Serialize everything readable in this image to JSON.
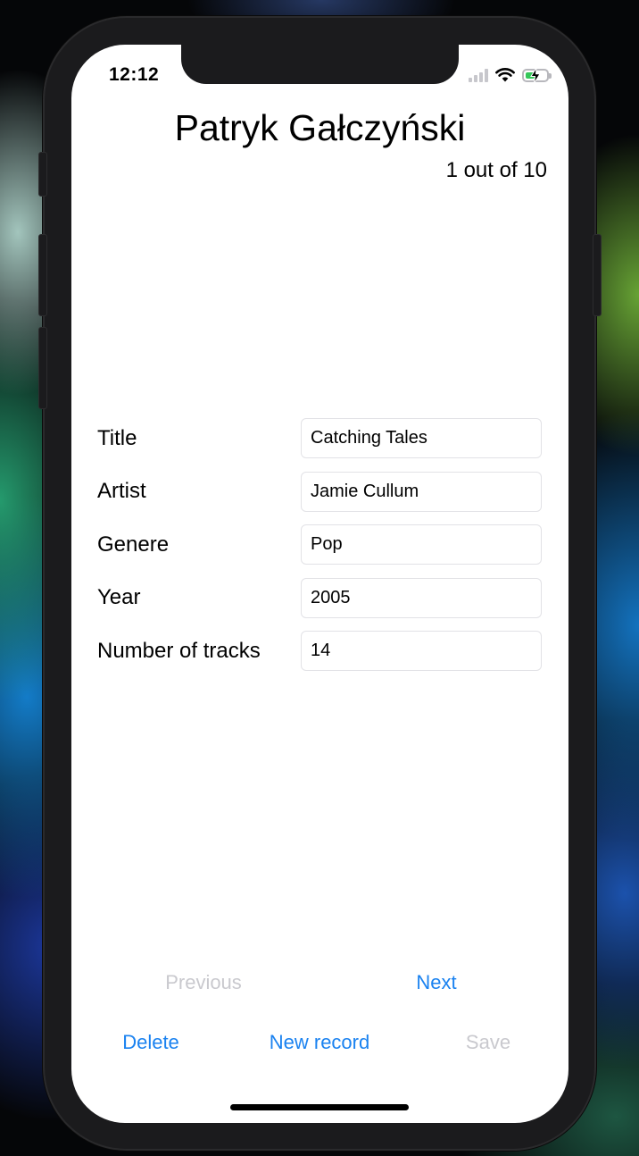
{
  "status_bar": {
    "time": "12:12",
    "signal_icon": "cellular-signal-icon",
    "wifi_icon": "wifi-icon",
    "battery_icon": "battery-charging-icon",
    "battery_color": "#34c759"
  },
  "header": {
    "title": "Patryk Gałczyński",
    "counter": "1 out of 10"
  },
  "form": {
    "fields": [
      {
        "label": "Title",
        "value": "Catching Tales"
      },
      {
        "label": "Artist",
        "value": "Jamie Cullum"
      },
      {
        "label": "Genere",
        "value": "Pop"
      },
      {
        "label": "Year",
        "value": "2005"
      },
      {
        "label": "Number of tracks",
        "value": "14"
      }
    ]
  },
  "navigation": {
    "previous_label": "Previous",
    "previous_enabled": false,
    "next_label": "Next",
    "next_enabled": true
  },
  "actions": {
    "delete_label": "Delete",
    "new_record_label": "New record",
    "save_label": "Save",
    "save_enabled": false
  },
  "colors": {
    "accent": "#1a82f0",
    "disabled": "#c9c9ce"
  }
}
